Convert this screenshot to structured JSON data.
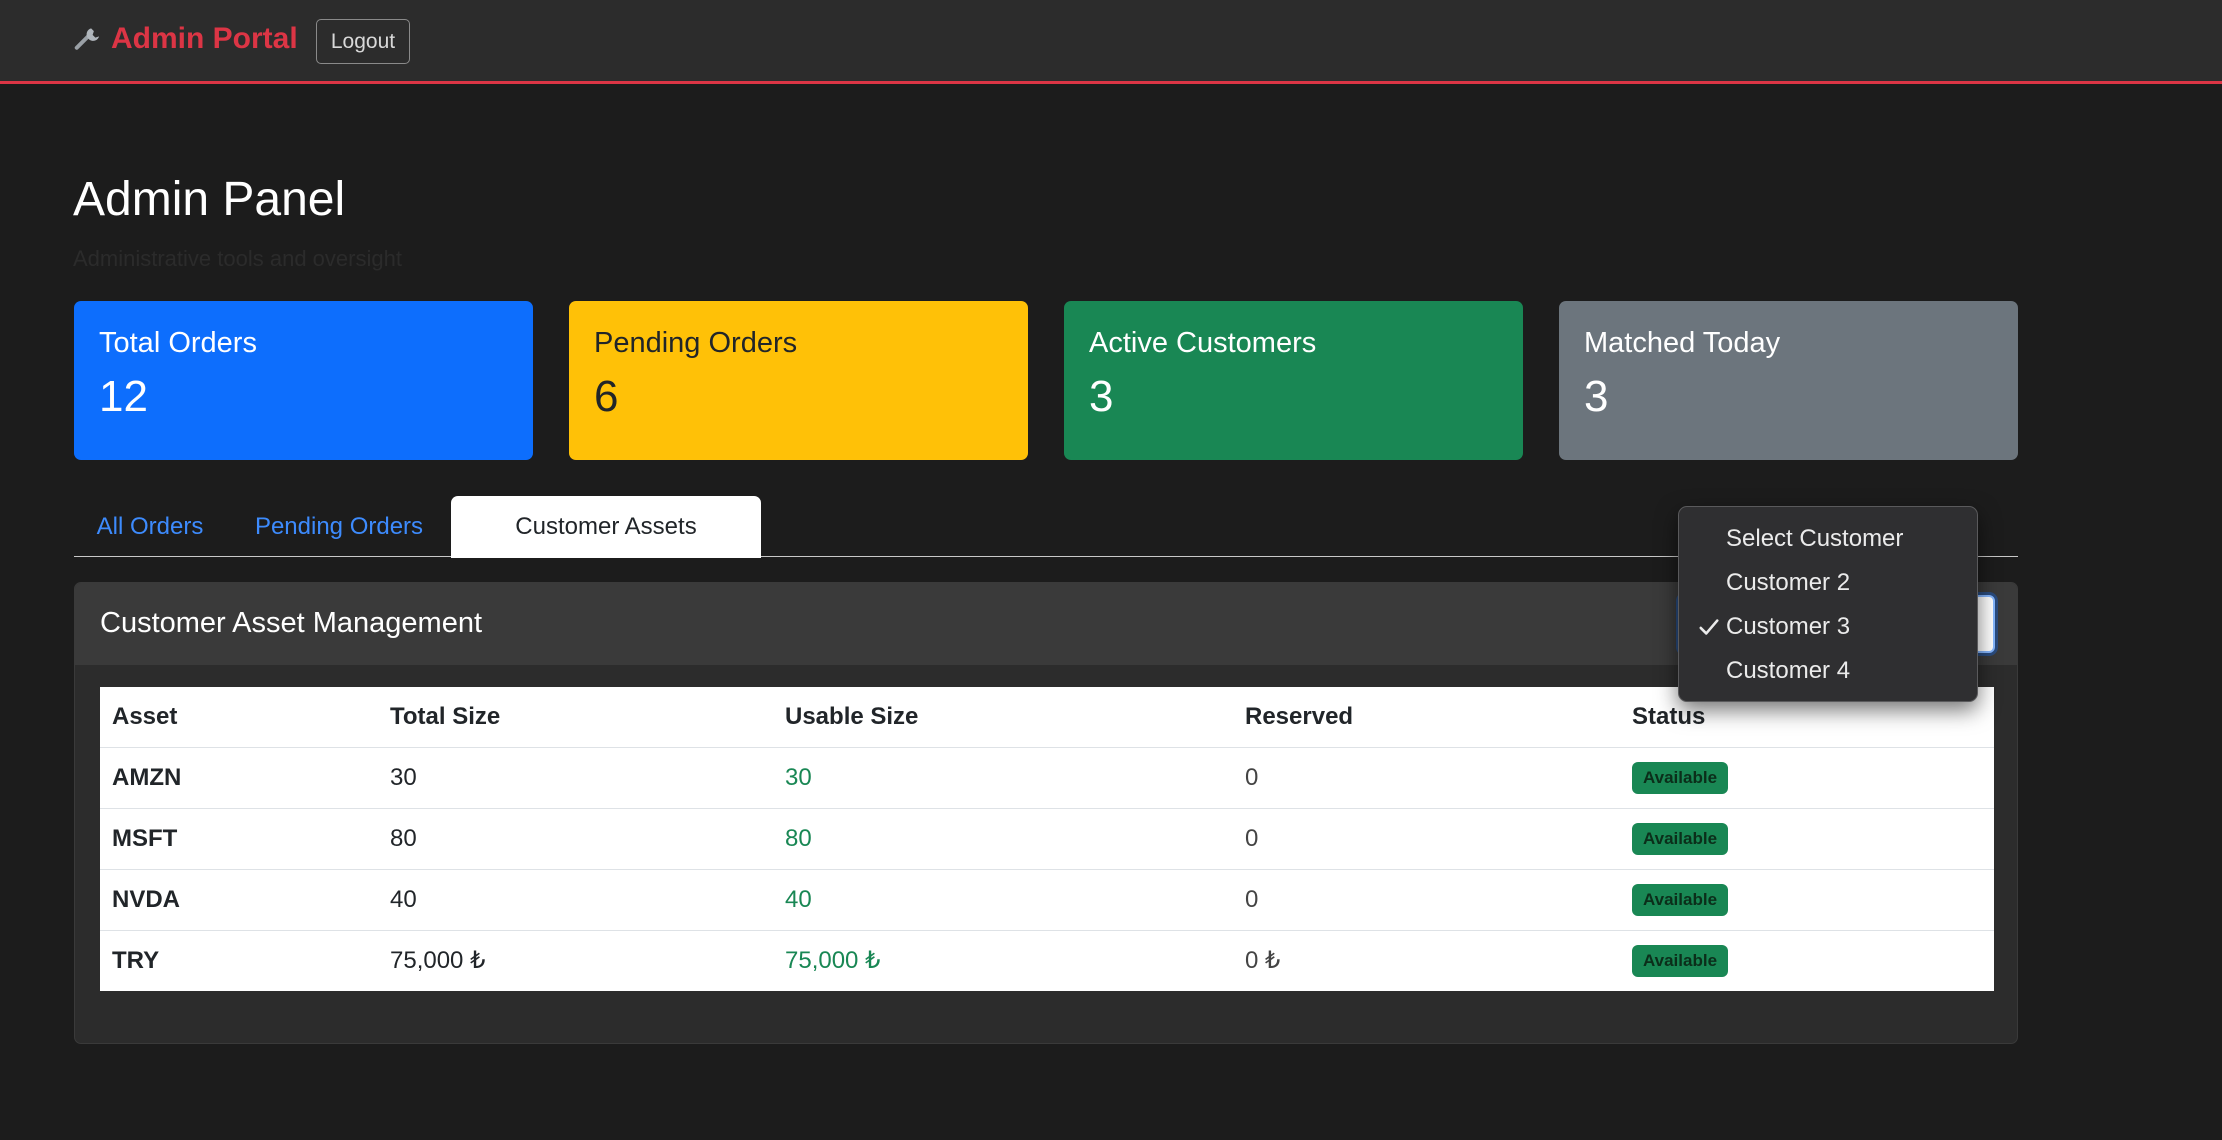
{
  "navbar": {
    "brand_label": "Admin Portal",
    "brand_icon": "wrench-icon",
    "logout_label": "Logout",
    "accent_color": "#dc3545"
  },
  "page": {
    "title": "Admin Panel",
    "subtitle": "Administrative tools and oversight"
  },
  "stats": [
    {
      "label": "Total Orders",
      "value": "12",
      "color": "#0d6efd"
    },
    {
      "label": "Pending Orders",
      "value": "6",
      "color": "#ffc107"
    },
    {
      "label": "Active Customers",
      "value": "3",
      "color": "#198754"
    },
    {
      "label": "Matched Today",
      "value": "3",
      "color": "#6c757d"
    }
  ],
  "tabs": [
    {
      "label": "All Orders",
      "active": false
    },
    {
      "label": "Pending Orders",
      "active": false
    },
    {
      "label": "Customer Assets",
      "active": true
    }
  ],
  "panel": {
    "title": "Customer Asset Management"
  },
  "customer_select": {
    "selected": "Customer 3",
    "options": [
      {
        "label": "Select Customer",
        "checked": false
      },
      {
        "label": "Customer 2",
        "checked": false
      },
      {
        "label": "Customer 3",
        "checked": true
      },
      {
        "label": "Customer 4",
        "checked": false
      }
    ]
  },
  "table": {
    "columns": [
      "Asset",
      "Total Size",
      "Usable Size",
      "Reserved",
      "Status"
    ],
    "rows": [
      {
        "asset": "AMZN",
        "total": "30",
        "usable": "30",
        "reserved": "0",
        "status": "Available"
      },
      {
        "asset": "MSFT",
        "total": "80",
        "usable": "80",
        "reserved": "0",
        "status": "Available"
      },
      {
        "asset": "NVDA",
        "total": "40",
        "usable": "40",
        "reserved": "0",
        "status": "Available"
      },
      {
        "asset": "TRY",
        "total": "75,000 ₺",
        "usable": "75,000 ₺",
        "reserved": "0 ₺",
        "status": "Available"
      }
    ]
  }
}
